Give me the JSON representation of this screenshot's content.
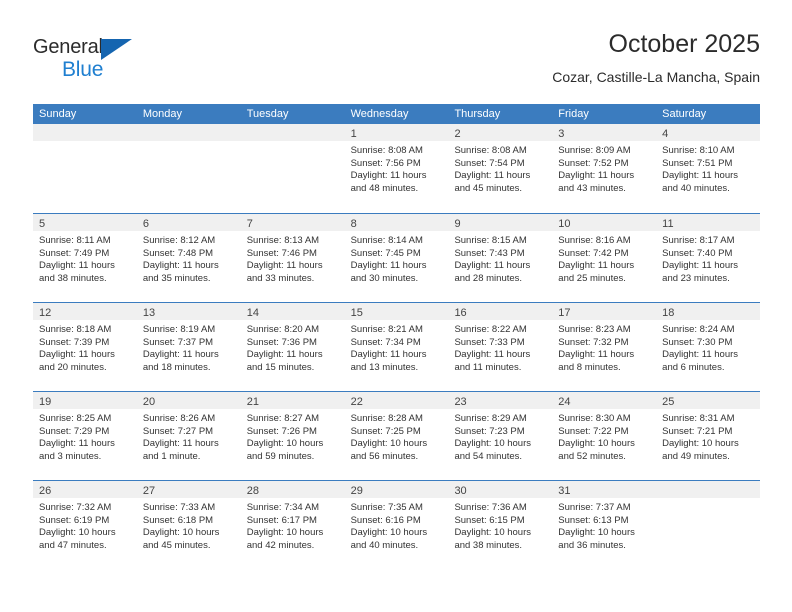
{
  "brand": {
    "name_part1": "General",
    "name_part2": "Blue",
    "triangle_color": "#1565b0",
    "blue_color": "#1f7fd0"
  },
  "header": {
    "month_title": "October 2025",
    "location": "Cozar, Castille-La Mancha, Spain"
  },
  "theme": {
    "header_blue": "#3b7cbf",
    "daynum_band": "#f0f0f0",
    "text": "#333333"
  },
  "weekday_headers": [
    "Sunday",
    "Monday",
    "Tuesday",
    "Wednesday",
    "Thursday",
    "Friday",
    "Saturday"
  ],
  "weeks": [
    [
      {
        "day": "",
        "sunrise": "",
        "sunset": "",
        "daylight1": "",
        "daylight2": "",
        "empty": true
      },
      {
        "day": "",
        "sunrise": "",
        "sunset": "",
        "daylight1": "",
        "daylight2": "",
        "empty": true
      },
      {
        "day": "",
        "sunrise": "",
        "sunset": "",
        "daylight1": "",
        "daylight2": "",
        "empty": true
      },
      {
        "day": "1",
        "sunrise": "Sunrise: 8:08 AM",
        "sunset": "Sunset: 7:56 PM",
        "daylight1": "Daylight: 11 hours",
        "daylight2": "and 48 minutes."
      },
      {
        "day": "2",
        "sunrise": "Sunrise: 8:08 AM",
        "sunset": "Sunset: 7:54 PM",
        "daylight1": "Daylight: 11 hours",
        "daylight2": "and 45 minutes."
      },
      {
        "day": "3",
        "sunrise": "Sunrise: 8:09 AM",
        "sunset": "Sunset: 7:52 PM",
        "daylight1": "Daylight: 11 hours",
        "daylight2": "and 43 minutes."
      },
      {
        "day": "4",
        "sunrise": "Sunrise: 8:10 AM",
        "sunset": "Sunset: 7:51 PM",
        "daylight1": "Daylight: 11 hours",
        "daylight2": "and 40 minutes."
      }
    ],
    [
      {
        "day": "5",
        "sunrise": "Sunrise: 8:11 AM",
        "sunset": "Sunset: 7:49 PM",
        "daylight1": "Daylight: 11 hours",
        "daylight2": "and 38 minutes."
      },
      {
        "day": "6",
        "sunrise": "Sunrise: 8:12 AM",
        "sunset": "Sunset: 7:48 PM",
        "daylight1": "Daylight: 11 hours",
        "daylight2": "and 35 minutes."
      },
      {
        "day": "7",
        "sunrise": "Sunrise: 8:13 AM",
        "sunset": "Sunset: 7:46 PM",
        "daylight1": "Daylight: 11 hours",
        "daylight2": "and 33 minutes."
      },
      {
        "day": "8",
        "sunrise": "Sunrise: 8:14 AM",
        "sunset": "Sunset: 7:45 PM",
        "daylight1": "Daylight: 11 hours",
        "daylight2": "and 30 minutes."
      },
      {
        "day": "9",
        "sunrise": "Sunrise: 8:15 AM",
        "sunset": "Sunset: 7:43 PM",
        "daylight1": "Daylight: 11 hours",
        "daylight2": "and 28 minutes."
      },
      {
        "day": "10",
        "sunrise": "Sunrise: 8:16 AM",
        "sunset": "Sunset: 7:42 PM",
        "daylight1": "Daylight: 11 hours",
        "daylight2": "and 25 minutes."
      },
      {
        "day": "11",
        "sunrise": "Sunrise: 8:17 AM",
        "sunset": "Sunset: 7:40 PM",
        "daylight1": "Daylight: 11 hours",
        "daylight2": "and 23 minutes."
      }
    ],
    [
      {
        "day": "12",
        "sunrise": "Sunrise: 8:18 AM",
        "sunset": "Sunset: 7:39 PM",
        "daylight1": "Daylight: 11 hours",
        "daylight2": "and 20 minutes."
      },
      {
        "day": "13",
        "sunrise": "Sunrise: 8:19 AM",
        "sunset": "Sunset: 7:37 PM",
        "daylight1": "Daylight: 11 hours",
        "daylight2": "and 18 minutes."
      },
      {
        "day": "14",
        "sunrise": "Sunrise: 8:20 AM",
        "sunset": "Sunset: 7:36 PM",
        "daylight1": "Daylight: 11 hours",
        "daylight2": "and 15 minutes."
      },
      {
        "day": "15",
        "sunrise": "Sunrise: 8:21 AM",
        "sunset": "Sunset: 7:34 PM",
        "daylight1": "Daylight: 11 hours",
        "daylight2": "and 13 minutes."
      },
      {
        "day": "16",
        "sunrise": "Sunrise: 8:22 AM",
        "sunset": "Sunset: 7:33 PM",
        "daylight1": "Daylight: 11 hours",
        "daylight2": "and 11 minutes."
      },
      {
        "day": "17",
        "sunrise": "Sunrise: 8:23 AM",
        "sunset": "Sunset: 7:32 PM",
        "daylight1": "Daylight: 11 hours",
        "daylight2": "and 8 minutes."
      },
      {
        "day": "18",
        "sunrise": "Sunrise: 8:24 AM",
        "sunset": "Sunset: 7:30 PM",
        "daylight1": "Daylight: 11 hours",
        "daylight2": "and 6 minutes."
      }
    ],
    [
      {
        "day": "19",
        "sunrise": "Sunrise: 8:25 AM",
        "sunset": "Sunset: 7:29 PM",
        "daylight1": "Daylight: 11 hours",
        "daylight2": "and 3 minutes."
      },
      {
        "day": "20",
        "sunrise": "Sunrise: 8:26 AM",
        "sunset": "Sunset: 7:27 PM",
        "daylight1": "Daylight: 11 hours",
        "daylight2": "and 1 minute."
      },
      {
        "day": "21",
        "sunrise": "Sunrise: 8:27 AM",
        "sunset": "Sunset: 7:26 PM",
        "daylight1": "Daylight: 10 hours",
        "daylight2": "and 59 minutes."
      },
      {
        "day": "22",
        "sunrise": "Sunrise: 8:28 AM",
        "sunset": "Sunset: 7:25 PM",
        "daylight1": "Daylight: 10 hours",
        "daylight2": "and 56 minutes."
      },
      {
        "day": "23",
        "sunrise": "Sunrise: 8:29 AM",
        "sunset": "Sunset: 7:23 PM",
        "daylight1": "Daylight: 10 hours",
        "daylight2": "and 54 minutes."
      },
      {
        "day": "24",
        "sunrise": "Sunrise: 8:30 AM",
        "sunset": "Sunset: 7:22 PM",
        "daylight1": "Daylight: 10 hours",
        "daylight2": "and 52 minutes."
      },
      {
        "day": "25",
        "sunrise": "Sunrise: 8:31 AM",
        "sunset": "Sunset: 7:21 PM",
        "daylight1": "Daylight: 10 hours",
        "daylight2": "and 49 minutes."
      }
    ],
    [
      {
        "day": "26",
        "sunrise": "Sunrise: 7:32 AM",
        "sunset": "Sunset: 6:19 PM",
        "daylight1": "Daylight: 10 hours",
        "daylight2": "and 47 minutes."
      },
      {
        "day": "27",
        "sunrise": "Sunrise: 7:33 AM",
        "sunset": "Sunset: 6:18 PM",
        "daylight1": "Daylight: 10 hours",
        "daylight2": "and 45 minutes."
      },
      {
        "day": "28",
        "sunrise": "Sunrise: 7:34 AM",
        "sunset": "Sunset: 6:17 PM",
        "daylight1": "Daylight: 10 hours",
        "daylight2": "and 42 minutes."
      },
      {
        "day": "29",
        "sunrise": "Sunrise: 7:35 AM",
        "sunset": "Sunset: 6:16 PM",
        "daylight1": "Daylight: 10 hours",
        "daylight2": "and 40 minutes."
      },
      {
        "day": "30",
        "sunrise": "Sunrise: 7:36 AM",
        "sunset": "Sunset: 6:15 PM",
        "daylight1": "Daylight: 10 hours",
        "daylight2": "and 38 minutes."
      },
      {
        "day": "31",
        "sunrise": "Sunrise: 7:37 AM",
        "sunset": "Sunset: 6:13 PM",
        "daylight1": "Daylight: 10 hours",
        "daylight2": "and 36 minutes."
      },
      {
        "day": "",
        "sunrise": "",
        "sunset": "",
        "daylight1": "",
        "daylight2": "",
        "empty": true
      }
    ]
  ]
}
